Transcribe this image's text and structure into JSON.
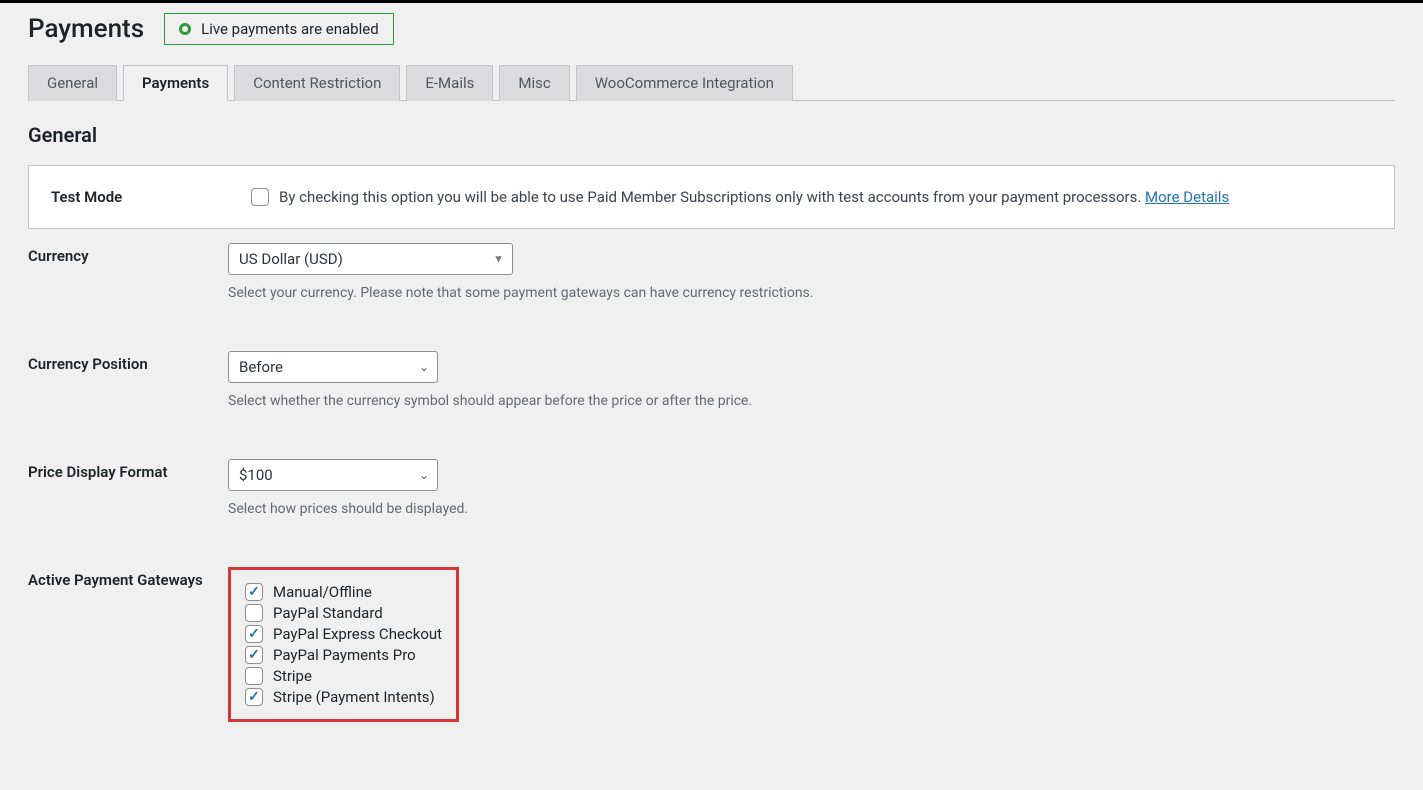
{
  "header": {
    "title": "Payments",
    "status_text": "Live payments are enabled"
  },
  "tabs": [
    {
      "label": "General"
    },
    {
      "label": "Payments"
    },
    {
      "label": "Content Restriction"
    },
    {
      "label": "E-Mails"
    },
    {
      "label": "Misc"
    },
    {
      "label": "WooCommerce Integration"
    }
  ],
  "section_title": "General",
  "test_mode": {
    "label": "Test Mode",
    "text": "By checking this option you will be able to use Paid Member Subscriptions only with test accounts from your payment processors. ",
    "link": "More Details"
  },
  "currency": {
    "label": "Currency",
    "value": "US Dollar (USD)",
    "desc": "Select your currency. Please note that some payment gateways can have currency restrictions."
  },
  "currency_position": {
    "label": "Currency Position",
    "value": "Before",
    "desc": "Select whether the currency symbol should appear before the price or after the price."
  },
  "price_format": {
    "label": "Price Display Format",
    "value": "$100",
    "desc": "Select how prices should be displayed."
  },
  "gateways": {
    "label": "Active Payment Gateways",
    "items": [
      {
        "label": "Manual/Offline",
        "checked": true
      },
      {
        "label": "PayPal Standard",
        "checked": false
      },
      {
        "label": "PayPal Express Checkout",
        "checked": true
      },
      {
        "label": "PayPal Payments Pro",
        "checked": true
      },
      {
        "label": "Stripe",
        "checked": false
      },
      {
        "label": "Stripe (Payment Intents)",
        "checked": true
      }
    ]
  }
}
